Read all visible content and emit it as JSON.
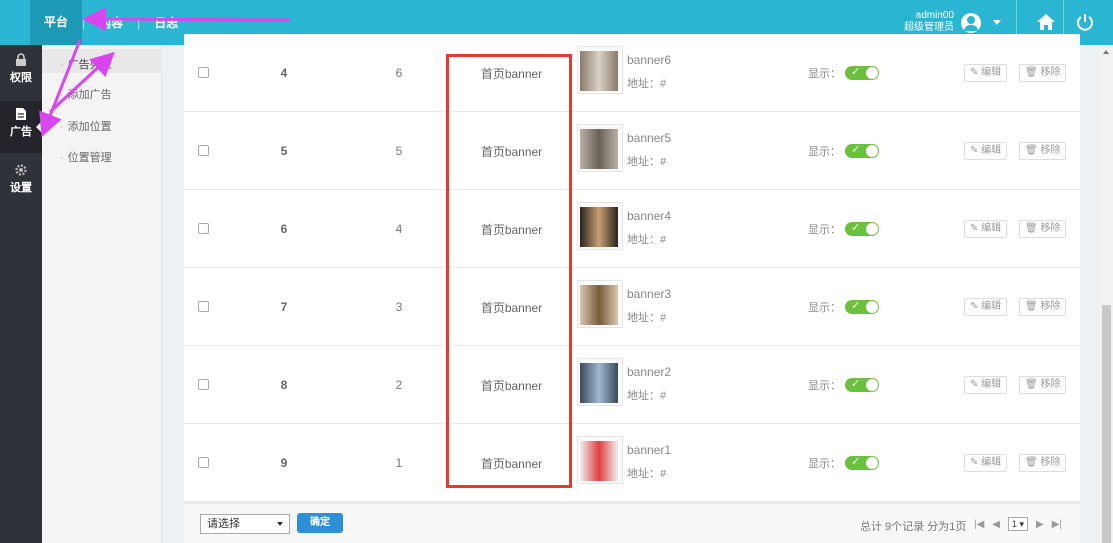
{
  "header": {
    "nav": [
      {
        "label": "平台",
        "active": true
      },
      {
        "label": "内容",
        "active": false
      },
      {
        "label": "日志",
        "active": false
      }
    ],
    "user_name": "admin00",
    "user_role": "超级管理员",
    "color": "#2ab5d3"
  },
  "sidebar": {
    "items": [
      {
        "label": "权限",
        "icon": "lock-icon"
      },
      {
        "label": "广告",
        "icon": "document-icon",
        "active": true
      },
      {
        "label": "设置",
        "icon": "gear-icon"
      }
    ]
  },
  "submenu": {
    "items": [
      {
        "label": "广告列表",
        "active": true
      },
      {
        "label": "添加广告"
      },
      {
        "label": "添加位置"
      },
      {
        "label": "位置管理"
      }
    ]
  },
  "table": {
    "rows": [
      {
        "id": "4",
        "order": "6",
        "position": "首页banner",
        "name": "banner6",
        "addr": "地址：#",
        "show_label": "显示：",
        "edit": "✎ 编辑",
        "delete": "🗑 移除",
        "visible": true
      },
      {
        "id": "5",
        "order": "5",
        "position": "首页banner",
        "name": "banner5",
        "addr": "地址：#",
        "show_label": "显示：",
        "edit": "✎ 编辑",
        "delete": "🗑 移除",
        "visible": true
      },
      {
        "id": "6",
        "order": "4",
        "position": "首页banner",
        "name": "banner4",
        "addr": "地址：#",
        "show_label": "显示：",
        "edit": "✎ 编辑",
        "delete": "🗑 移除",
        "visible": true
      },
      {
        "id": "7",
        "order": "3",
        "position": "首页banner",
        "name": "banner3",
        "addr": "地址：#",
        "show_label": "显示：",
        "edit": "✎ 编辑",
        "delete": "🗑 移除",
        "visible": true
      },
      {
        "id": "8",
        "order": "2",
        "position": "首页banner",
        "name": "banner2",
        "addr": "地址：#",
        "show_label": "显示：",
        "edit": "✎ 编辑",
        "delete": "🗑 移除",
        "visible": true
      },
      {
        "id": "9",
        "order": "1",
        "position": "首页banner",
        "name": "banner1",
        "addr": "地址：#",
        "show_label": "显示：",
        "edit": "✎ 编辑",
        "delete": "🗑 移除",
        "visible": true
      }
    ]
  },
  "footer": {
    "select_value": "请选择",
    "confirm_label": "确定",
    "page_info": "总计 9个记录 分为1页",
    "current_page": "1 ▾"
  },
  "colors": {
    "toggle_on": "#6bc13d",
    "highlight": "#e53935",
    "arrow": "#d946ef"
  }
}
